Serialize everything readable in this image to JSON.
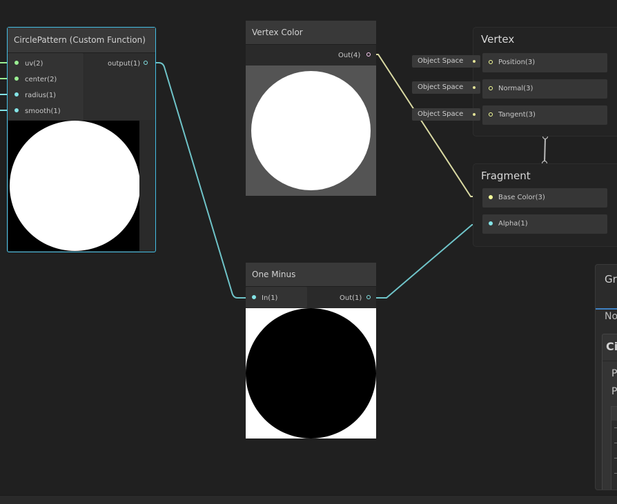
{
  "colors": {
    "float_port": "#84e4e7",
    "vector2_port": "#9aef92",
    "vector3_port": "#f6ff9a",
    "vector4_port": "#fbcbf4",
    "selection": "#44c0e6"
  },
  "nodes": {
    "circle_pattern": {
      "title": "CirclePattern (Custom Function)",
      "inputs": [
        "uv(2)",
        "center(2)",
        "radius(1)",
        "smooth(1)"
      ],
      "output": "output(1)"
    },
    "vertex_color": {
      "title": "Vertex Color",
      "output": "Out(4)"
    },
    "one_minus": {
      "title": "One Minus",
      "input": "In(1)",
      "output": "Out(1)"
    }
  },
  "master": {
    "vertex": {
      "title": "Vertex",
      "slots": [
        "Position(3)",
        "Normal(3)",
        "Tangent(3)"
      ],
      "space_labels": [
        "Object Space",
        "Object Space",
        "Object Space"
      ]
    },
    "fragment": {
      "title": "Fragment",
      "slots": [
        "Base Color(3)",
        "Alpha(1)"
      ]
    }
  },
  "blackboard": {
    "title_fragment": "Gr",
    "subtitle_fragment": "No",
    "section_fragment": "Ci",
    "row_fragments": [
      "P",
      "P"
    ]
  }
}
